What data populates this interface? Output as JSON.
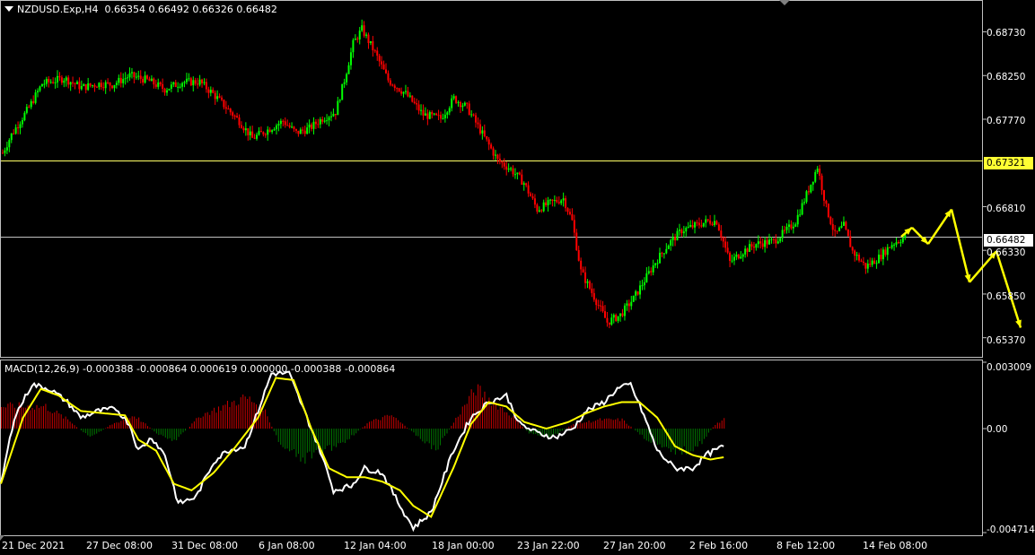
{
  "header": {
    "symbol": "NZDUSD.Exp,H4",
    "ohlc": "0.66354 0.66492 0.66326 0.66482"
  },
  "macd_header": {
    "label": "MACD(12,26,9) -0.000388 -0.000864 0.000619 0.000000 -0.000388 -0.000864"
  },
  "colors": {
    "background": "#000000",
    "frame": "#c0c0c0",
    "bull_candle": "#00ff00",
    "bear_candle": "#ff0000",
    "hline_resistance": "#ffff66",
    "hline_current": "#c0c0c0",
    "forecast_arrows": "#ffff00",
    "macd_line": "#ffffff",
    "signal_line": "#ffff00",
    "hist_positive": "#cc0000",
    "hist_negative": "#007700"
  },
  "price_axis": {
    "ticks": [
      "0.68730",
      "0.68250",
      "0.67770",
      "0.66810",
      "0.66330",
      "0.65850",
      "0.65370"
    ]
  },
  "macd_axis": {
    "ticks": [
      "0.003009",
      "0.00",
      "-0.004714"
    ]
  },
  "time_axis": {
    "ticks": [
      "21 Dec 2021",
      "27 Dec 08:00",
      "31 Dec 08:00",
      "6 Jan 08:00",
      "12 Jan 04:00",
      "18 Jan 00:00",
      "23 Jan 22:00",
      "27 Jan 20:00",
      "2 Feb 16:00",
      "8 Feb 12:00",
      "14 Feb 08:00"
    ]
  },
  "chart_data": [
    {
      "type": "candlestick",
      "symbol": "NZDUSD.Exp",
      "timeframe": "H4",
      "ylim": [
        0.6515,
        0.6908
      ],
      "horizontal_lines": [
        {
          "value": "0.67321",
          "label": "0.67321",
          "style": "resistance"
        },
        {
          "value": "0.66482",
          "label": "0.66482",
          "style": "current"
        }
      ],
      "close_path": [
        [
          0,
          0.674
        ],
        [
          4,
          0.676
        ],
        [
          12,
          0.679
        ],
        [
          18,
          0.6816
        ],
        [
          28,
          0.6822
        ],
        [
          36,
          0.6812
        ],
        [
          44,
          0.6816
        ],
        [
          50,
          0.6815
        ],
        [
          58,
          0.6825
        ],
        [
          66,
          0.682
        ],
        [
          74,
          0.681
        ],
        [
          82,
          0.6818
        ],
        [
          90,
          0.6818
        ],
        [
          96,
          0.6805
        ],
        [
          102,
          0.679
        ],
        [
          108,
          0.6775
        ],
        [
          114,
          0.6756
        ],
        [
          120,
          0.6764
        ],
        [
          128,
          0.6775
        ],
        [
          134,
          0.6762
        ],
        [
          140,
          0.6767
        ],
        [
          146,
          0.6778
        ],
        [
          152,
          0.6785
        ],
        [
          156,
          0.682
        ],
        [
          160,
          0.686
        ],
        [
          164,
          0.6876
        ],
        [
          170,
          0.685
        ],
        [
          176,
          0.682
        ],
        [
          184,
          0.6805
        ],
        [
          192,
          0.6782
        ],
        [
          200,
          0.6778
        ],
        [
          206,
          0.68
        ],
        [
          212,
          0.679
        ],
        [
          218,
          0.6765
        ],
        [
          226,
          0.6732
        ],
        [
          232,
          0.6722
        ],
        [
          238,
          0.6707
        ],
        [
          244,
          0.6678
        ],
        [
          250,
          0.6685
        ],
        [
          256,
          0.669
        ],
        [
          260,
          0.6665
        ],
        [
          264,
          0.661
        ],
        [
          270,
          0.6582
        ],
        [
          276,
          0.6554
        ],
        [
          282,
          0.6562
        ],
        [
          288,
          0.658
        ],
        [
          292,
          0.6596
        ],
        [
          298,
          0.662
        ],
        [
          304,
          0.664
        ],
        [
          310,
          0.6655
        ],
        [
          316,
          0.666
        ],
        [
          322,
          0.6665
        ],
        [
          326,
          0.6665
        ],
        [
          332,
          0.662
        ],
        [
          338,
          0.6632
        ],
        [
          344,
          0.664
        ],
        [
          352,
          0.6643
        ],
        [
          358,
          0.6655
        ],
        [
          362,
          0.6665
        ],
        [
          368,
          0.67
        ],
        [
          372,
          0.6725
        ],
        [
          376,
          0.668
        ],
        [
          380,
          0.665
        ],
        [
          384,
          0.666
        ],
        [
          388,
          0.6632
        ],
        [
          394,
          0.6615
        ],
        [
          400,
          0.6625
        ],
        [
          406,
          0.664
        ],
        [
          412,
          0.6648
        ]
      ],
      "forecast_path": [
        [
          0.6648,
          0.6658
        ],
        [
          0.6658,
          0.664
        ],
        [
          0.664,
          0.6678
        ],
        [
          0.6678,
          0.6598
        ],
        [
          0.6598,
          0.6632
        ],
        [
          0.6632,
          0.6548
        ]
      ],
      "price_ticks": [
        0.6873,
        0.6825,
        0.6777,
        0.6681,
        0.6633,
        0.6585,
        0.6537
      ]
    },
    {
      "type": "line",
      "name": "MACD(12,26,9)",
      "ylim": [
        -0.004714,
        0.003009
      ],
      "series": [
        {
          "role": "macd",
          "values": [
            [
              0,
              -0.0025
            ],
            [
              6,
              0.0005
            ],
            [
              14,
              0.002
            ],
            [
              22,
              0.0018
            ],
            [
              30,
              0.0012
            ],
            [
              36,
              0.0005
            ],
            [
              44,
              0.0008
            ],
            [
              52,
              0.0009
            ],
            [
              58,
              0.0002
            ],
            [
              62,
              -0.001
            ],
            [
              68,
              -0.0004
            ],
            [
              74,
              -0.0012
            ],
            [
              80,
              -0.0034
            ],
            [
              88,
              -0.0031
            ],
            [
              96,
              -0.0015
            ],
            [
              102,
              -0.001
            ],
            [
              110,
              -0.0008
            ],
            [
              116,
              0.0008
            ],
            [
              122,
              0.0025
            ],
            [
              130,
              0.0025
            ],
            [
              136,
              0.001
            ],
            [
              144,
              -0.001
            ],
            [
              150,
              -0.0028
            ],
            [
              158,
              -0.0026
            ],
            [
              164,
              -0.0018
            ],
            [
              172,
              -0.002
            ],
            [
              180,
              -0.0035
            ],
            [
              186,
              -0.0045
            ],
            [
              194,
              -0.0038
            ],
            [
              204,
              -0.001
            ],
            [
              212,
              0.0005
            ],
            [
              220,
              0.0012
            ],
            [
              228,
              0.0015
            ],
            [
              234,
              0.0002
            ],
            [
              242,
              -0.0002
            ],
            [
              250,
              -0.0004
            ],
            [
              258,
              0.0
            ],
            [
              264,
              0.0008
            ],
            [
              272,
              0.0012
            ],
            [
              278,
              0.0018
            ],
            [
              284,
              0.002
            ],
            [
              290,
              0.0006
            ],
            [
              296,
              -0.001
            ],
            [
              304,
              -0.0018
            ],
            [
              312,
              -0.0018
            ],
            [
              318,
              -0.0012
            ],
            [
              326,
              -0.0008
            ]
          ]
        },
        {
          "role": "signal",
          "values": [
            [
              0,
              -0.0025
            ],
            [
              10,
              0.0005
            ],
            [
              18,
              0.0018
            ],
            [
              26,
              0.0015
            ],
            [
              36,
              0.0008
            ],
            [
              46,
              0.0007
            ],
            [
              56,
              0.0006
            ],
            [
              62,
              -0.0005
            ],
            [
              70,
              -0.001
            ],
            [
              78,
              -0.0025
            ],
            [
              86,
              -0.0028
            ],
            [
              96,
              -0.002
            ],
            [
              106,
              -0.0008
            ],
            [
              116,
              0.0005
            ],
            [
              124,
              0.0023
            ],
            [
              132,
              0.0022
            ],
            [
              140,
              0.0
            ],
            [
              148,
              -0.0018
            ],
            [
              156,
              -0.0022
            ],
            [
              164,
              -0.0022
            ],
            [
              172,
              -0.0024
            ],
            [
              180,
              -0.0028
            ],
            [
              186,
              -0.0035
            ],
            [
              194,
              -0.004
            ],
            [
              204,
              -0.0018
            ],
            [
              212,
              0.0002
            ],
            [
              220,
              0.0012
            ],
            [
              228,
              0.001
            ],
            [
              236,
              0.0003
            ],
            [
              246,
              0.0
            ],
            [
              256,
              0.0003
            ],
            [
              264,
              0.0007
            ],
            [
              272,
              0.001
            ],
            [
              280,
              0.0012
            ],
            [
              288,
              0.0012
            ],
            [
              296,
              0.0005
            ],
            [
              304,
              -0.0008
            ],
            [
              312,
              -0.0012
            ],
            [
              320,
              -0.0014
            ],
            [
              326,
              -0.0013
            ]
          ]
        }
      ],
      "histogram_shape": [
        [
          0,
          0.001
        ],
        [
          20,
          0.001
        ],
        [
          30,
          0.0004
        ],
        [
          40,
          -0.0004
        ],
        [
          50,
          0.0002
        ],
        [
          60,
          0.0006
        ],
        [
          70,
          -0.0002
        ],
        [
          78,
          -0.0006
        ],
        [
          90,
          0.0006
        ],
        [
          100,
          0.001
        ],
        [
          110,
          0.0014
        ],
        [
          118,
          0.001
        ],
        [
          126,
          -0.0008
        ],
        [
          136,
          -0.0014
        ],
        [
          146,
          -0.001
        ],
        [
          156,
          -0.0005
        ],
        [
          166,
          0.0003
        ],
        [
          176,
          0.0006
        ],
        [
          186,
          -0.0002
        ],
        [
          196,
          -0.001
        ],
        [
          206,
          0.0006
        ],
        [
          214,
          0.0018
        ],
        [
          222,
          0.0012
        ],
        [
          230,
          0.0006
        ],
        [
          238,
          -0.0002
        ],
        [
          248,
          -0.0004
        ],
        [
          258,
          0.0002
        ],
        [
          270,
          0.0004
        ],
        [
          280,
          0.0004
        ],
        [
          290,
          -0.0004
        ],
        [
          300,
          -0.001
        ],
        [
          310,
          -0.001
        ],
        [
          316,
          -0.0006
        ],
        [
          322,
          0.0002
        ],
        [
          326,
          0.0004
        ]
      ],
      "histogram_length": 327
    }
  ]
}
